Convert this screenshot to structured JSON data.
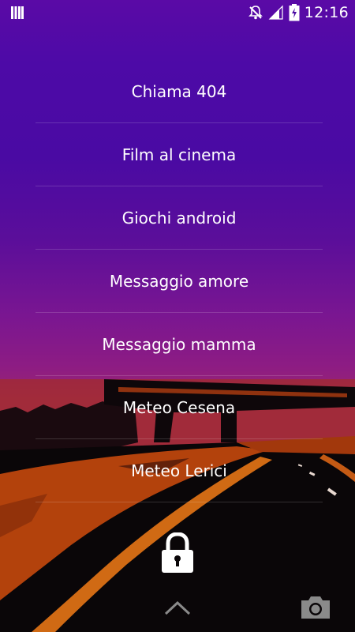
{
  "status_bar": {
    "time": "12:16",
    "icons": [
      "notification-bars-icon",
      "mute-icon",
      "signal-icon",
      "battery-charging-icon"
    ]
  },
  "menu": {
    "items": [
      {
        "label": "Chiama 404"
      },
      {
        "label": "Film al cinema"
      },
      {
        "label": "Giochi android"
      },
      {
        "label": "Messaggio amore"
      },
      {
        "label": "Messaggio mamma"
      },
      {
        "label": "Meteo Cesena"
      },
      {
        "label": "Meteo Lerici"
      }
    ]
  },
  "lockscreen": {
    "lock_icon": "lock-icon",
    "unlock_hint_icon": "chevron-up-icon",
    "camera_icon": "camera-icon"
  },
  "colors": {
    "sky_top": "#5a0aa6",
    "sky_horizon": "#9a2670",
    "road_orange": "#b3420c",
    "ground_dark": "#0a0608"
  }
}
